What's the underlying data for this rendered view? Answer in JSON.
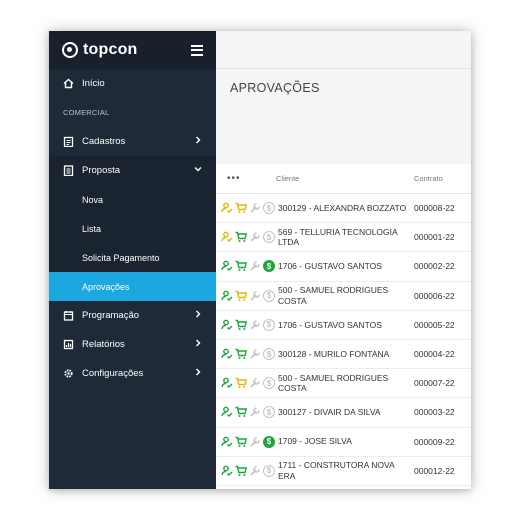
{
  "brand": {
    "logo_text": "topcon"
  },
  "sidebar": {
    "inicio": "Início",
    "section_comercial": "COMERCIAL",
    "cadastros": "Cadastros",
    "proposta": "Proposta",
    "sub": [
      "Nova",
      "Lista",
      "Solicita Pagamento",
      "Aprovações"
    ],
    "programacao": "Programação",
    "relatorios": "Relatórios",
    "configuracoes": "Configurações",
    "active_sub": "Aprovações"
  },
  "page": {
    "title": "APROVAÇÕES"
  },
  "table": {
    "more_label": "•••",
    "col_client": "Cliente",
    "col_contract": "Contrato",
    "rows": [
      {
        "client": "300129 - ALEXANDRA BOZZATO",
        "contract": "000008-22",
        "person_color": "#e0b800",
        "cart_color": "#e0b800",
        "coin": false
      },
      {
        "client": "569 - TELLURIA TECNOLOGIA LTDA",
        "contract": "000001-22",
        "person_color": "#e0b800",
        "cart_color": "#1fa53a",
        "coin": false
      },
      {
        "client": "1706 - GUSTAVO SANTOS",
        "contract": "000002-22",
        "person_color": "#1fa53a",
        "cart_color": "#1fa53a",
        "coin": true
      },
      {
        "client": "500 - SAMUEL RODRIGUES COSTA",
        "contract": "000006-22",
        "person_color": "#1fa53a",
        "cart_color": "#e0b800",
        "coin": false
      },
      {
        "client": "1706 - GUSTAVO SANTOS",
        "contract": "000005-22",
        "person_color": "#1fa53a",
        "cart_color": "#1fa53a",
        "coin": false
      },
      {
        "client": "300128 - MURILO FONTANA",
        "contract": "000004-22",
        "person_color": "#1fa53a",
        "cart_color": "#1fa53a",
        "coin": false
      },
      {
        "client": "500 - SAMUEL RODRIGUES COSTA",
        "contract": "000007-22",
        "person_color": "#1fa53a",
        "cart_color": "#e0b800",
        "coin": false
      },
      {
        "client": "300127 - DIVAIR DA SILVA",
        "contract": "000003-22",
        "person_color": "#1fa53a",
        "cart_color": "#1fa53a",
        "coin": false
      },
      {
        "client": "1709 - JOSE SILVA",
        "contract": "000009-22",
        "person_color": "#1fa53a",
        "cart_color": "#1fa53a",
        "coin": true
      },
      {
        "client": "1711 - CONSTRUTORA NOVA ERA",
        "contract": "000012-22",
        "person_color": "#1fa53a",
        "cart_color": "#1fa53a",
        "coin": false
      }
    ]
  },
  "colors": {
    "sidebar": "#1e2a38",
    "active": "#1ca7e0",
    "green": "#1fa53a",
    "yellow": "#e0b800",
    "grey_icon": "#c4c4c4"
  }
}
